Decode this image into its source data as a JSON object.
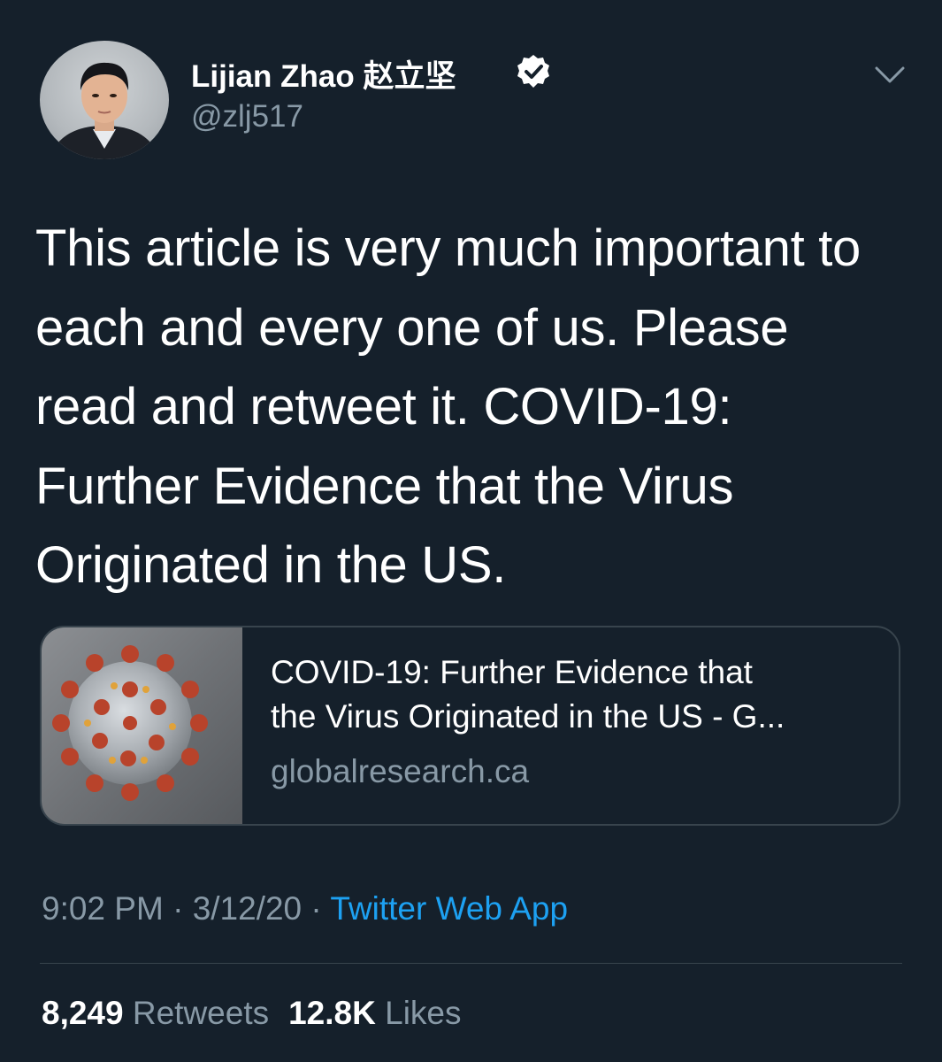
{
  "author": {
    "name": "Lijian Zhao 赵立坚",
    "handle": "@zlj517",
    "verified": true,
    "avatar_icon": "profile-photo"
  },
  "menu_icon": "chevron-down-icon",
  "tweet": {
    "lines": [
      "This article is very much important to",
      "each and every one of us. Please",
      "read and retweet it. COVID-19:",
      "Further Evidence that the Virus",
      "Originated in the US."
    ]
  },
  "card": {
    "title_lines": [
      "COVID-19: Further Evidence that",
      "the Virus Originated in the US - G..."
    ],
    "domain": "globalresearch.ca",
    "image_icon": "coronavirus-image"
  },
  "meta": {
    "time": "9:02 PM",
    "separator": " · ",
    "date": "3/12/20",
    "source": "Twitter Web App"
  },
  "stats": {
    "retweets_count": "8,249",
    "retweets_label": "Retweets",
    "likes_count": "12.8K",
    "likes_label": "Likes"
  },
  "colors": {
    "background": "#15202b",
    "text_primary": "#ffffff",
    "text_secondary": "#8899a6",
    "link": "#1da1f2",
    "border": "#38444d"
  }
}
